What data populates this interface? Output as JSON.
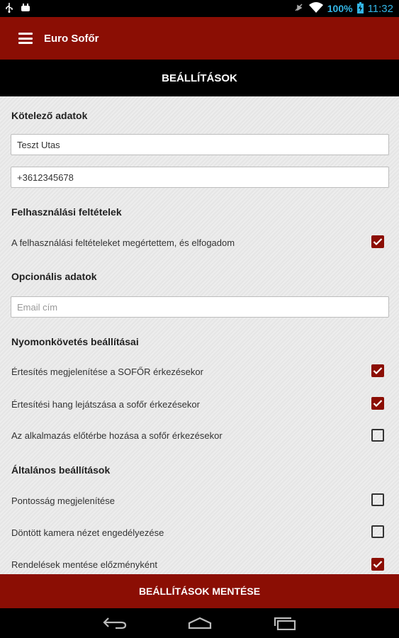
{
  "statusbar": {
    "battery": "100%",
    "time": "11:32"
  },
  "appbar": {
    "title": "Euro Sofőr",
    "menu_icon": "hamburger-icon"
  },
  "subheader": {
    "title": "BEÁLLÍTÁSOK"
  },
  "required": {
    "title": "Kötelező adatok",
    "name_value": "Teszt Utas",
    "phone_value": "+3612345678"
  },
  "terms": {
    "title": "Felhasználási feltételek",
    "accept_label": "A felhasználási feltételeket megértettem, és elfogadom",
    "accept_checked": true
  },
  "optional": {
    "title": "Opcionális adatok",
    "email_placeholder": "Email cím"
  },
  "tracking": {
    "title": "Nyomonkövetés beállításai",
    "items": [
      {
        "label": "Értesítés megjelenítése a SOFŐR érkezésekor",
        "checked": true
      },
      {
        "label": "Értesítési hang lejátszása a sofőr érkezésekor",
        "checked": true
      },
      {
        "label": "Az alkalmazás előtérbe hozása a sofőr érkezésekor",
        "checked": false
      }
    ]
  },
  "general": {
    "title": "Általános beállítások",
    "items": [
      {
        "label": "Pontosság megjelenítése",
        "checked": false
      },
      {
        "label": "Döntött kamera nézet engedélyezése",
        "checked": false
      },
      {
        "label": "Rendelések mentése előzményként",
        "checked": true
      }
    ]
  },
  "save_button": {
    "label": "BEÁLLÍTÁSOK MENTÉSE"
  },
  "colors": {
    "primary": "#8b0e04",
    "accent": "#33b5e5"
  }
}
